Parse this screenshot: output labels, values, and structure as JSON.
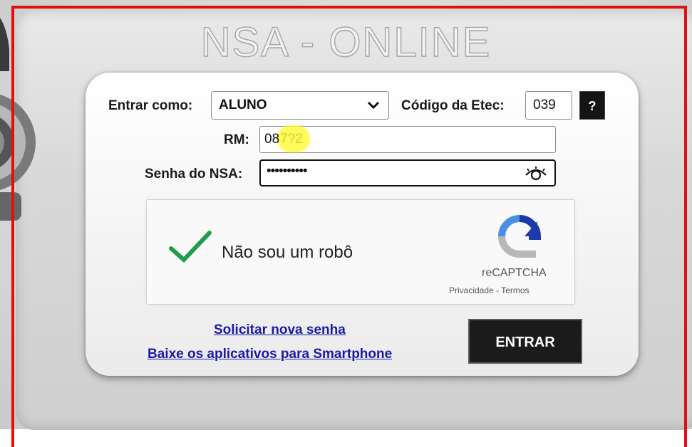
{
  "header": {
    "title": "NSA - ONLINE"
  },
  "login_form": {
    "role_label": "Entrar como:",
    "role_value": "ALUNO",
    "etec_label": "Código da Etec:",
    "etec_value": "039",
    "help_label": "?",
    "rm_label": "RM:",
    "rm_value_visible": "08",
    "rm_value_obscured": "7?2",
    "password_label": "Senha do NSA:",
    "password_value": "••••••••••"
  },
  "captcha": {
    "label": "Não sou um robô",
    "brand": "reCAPTCHA",
    "links": "Privacidade - Termos",
    "checked": true
  },
  "links": {
    "new_password": "Solicitar nova senha",
    "apps": "Baixe os aplicativos para Smartphone"
  },
  "actions": {
    "enter_label": "ENTRAR"
  },
  "colors": {
    "frame": "#e01010",
    "check": "#1e9e4a",
    "link": "#1a1aa6",
    "button": "#1b1b1b"
  }
}
